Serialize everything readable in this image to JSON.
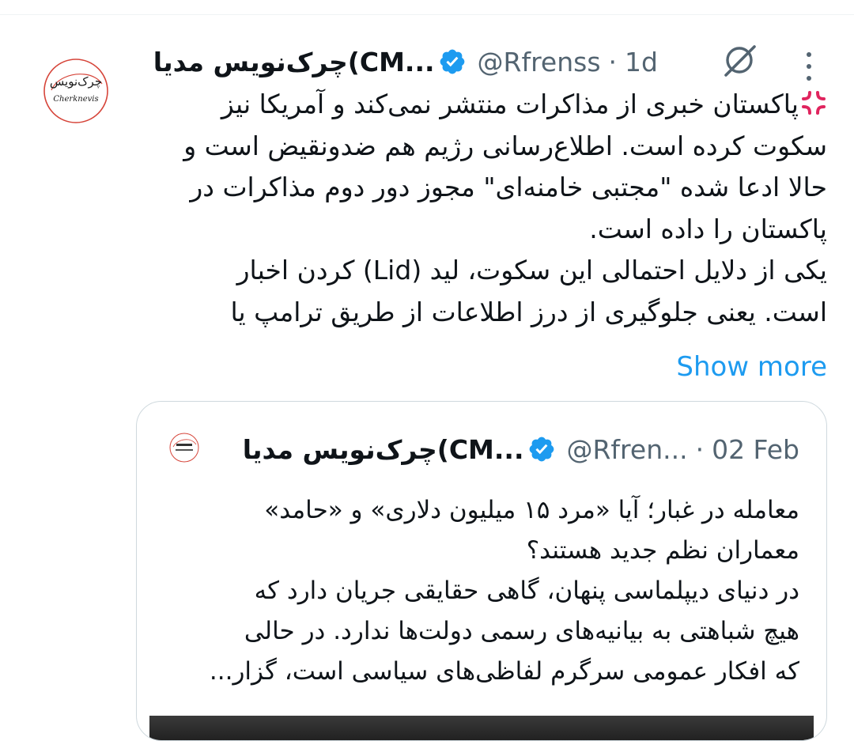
{
  "tweet": {
    "display_name": "چرک‌نویس مدیا(CM...",
    "handle": "@Rfrenss",
    "separator": "·",
    "time": "1d",
    "logo_text_top": "چرک‌نویس",
    "logo_text_bottom": "Cherknevis",
    "lines": [
      "پاکستان خبری از مذاکرات منتشر نمی‌کند و آمریکا نیز",
      "سکوت کرده است. اطلاع‌رسانی رژیم هم ضدونقیض است و",
      "حالا ادعا شده \"مجتبی خامنه‌ای\" مجوز دور دوم مذاکرات در",
      "پاکستان را داده است.",
      "یکی از دلایل احتمالی این سکوت، لید (Lid) کردن اخبار",
      "است. یعنی جلوگیری از درز اطلاعات از طریق ترامپ یا"
    ],
    "show_more": "Show more"
  },
  "quote": {
    "display_name": "چرک‌نویس مدیا(CM...",
    "handle": "@Rfren...",
    "separator": "·",
    "time": "02 Feb",
    "lines": [
      "معامله در غبار؛ آیا «مرد ۱۵ میلیون دلاری» و «حامد»",
      "معماران نظم جدید هستند؟",
      "در دنیای دیپلماسی پنهان، گاهی حقایقی جریان دارد که",
      "هیچ شباهتی به بیانیه‌های رسمی دولت‌ها ندارد. در حالی",
      "که افکار عمومی سرگرم لفاظی‌های سیاسی است، گزار..."
    ]
  },
  "colors": {
    "text": "#0f1419",
    "secondary": "#536471",
    "link": "#1d9bf0",
    "verified": "#1d9bf0",
    "border": "#cfd9de",
    "logo_red": "#d6453a"
  },
  "icons": {
    "verified": "verified-badge-icon",
    "grok": "grok-icon",
    "more": "more-vertical-icon",
    "angry": "anger-symbol-emoji"
  }
}
